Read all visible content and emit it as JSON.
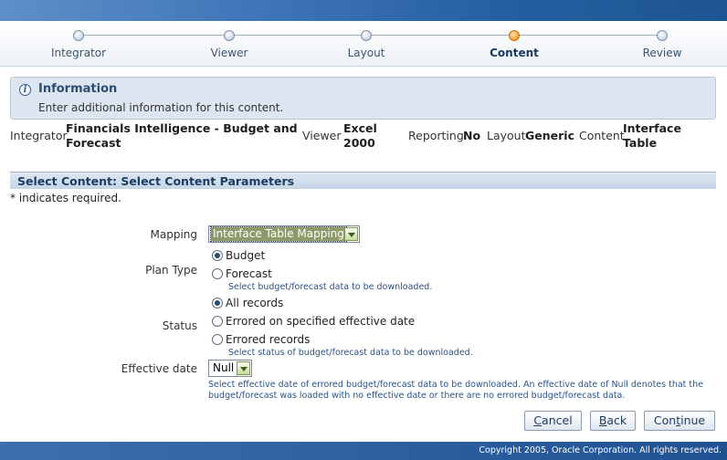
{
  "train": {
    "steps": [
      {
        "label": "Integrator"
      },
      {
        "label": "Viewer"
      },
      {
        "label": "Layout"
      },
      {
        "label": "Content"
      },
      {
        "label": "Review"
      }
    ],
    "active_step": "Content"
  },
  "info": {
    "title": "Information",
    "message": "Enter additional information for this content."
  },
  "context": {
    "integrator_label": "Integrator",
    "integrator_value_line1": "Financials Intelligence - Budget and",
    "integrator_value_line2": "Forecast",
    "viewer_label": "Viewer",
    "viewer_value_line1": "Excel",
    "viewer_value_line2": "2000",
    "reporting_label": "Reporting",
    "reporting_value": "No",
    "layout_label": "Layout",
    "layout_value": "Generic",
    "content_label": "Content",
    "content_value_line1": "Interface",
    "content_value_line2": "Table"
  },
  "section": {
    "title": "Select Content: Select Content Parameters",
    "required_note": "* indicates required."
  },
  "form": {
    "mapping_label": "Mapping",
    "mapping_value": "Interface Table Mapping",
    "plan_type_label": "Plan Type",
    "plan_type_options": [
      "Budget",
      "Forecast"
    ],
    "plan_type_selected": "Budget",
    "plan_type_hint": "Select budget/forecast data to be downloaded.",
    "status_label": "Status",
    "status_options": [
      "All records",
      "Errored on specified effective date",
      "Errored records"
    ],
    "status_selected": "All records",
    "status_hint": "Select status of budget/forecast data to be downloaded.",
    "effective_date_label": "Effective date",
    "effective_date_value": "Null",
    "effective_date_hint_line1": "Select effective date of errored budget/forecast data to be downloaded. An effective date of Null denotes that the",
    "effective_date_hint_line2": "budget/forecast was loaded with no effective date or there are no errored budget/forecast data."
  },
  "buttons": {
    "cancel_u": "C",
    "cancel_rest": "ancel",
    "back_u": "B",
    "back_rest": "ack",
    "continue_pre": "Con",
    "continue_u": "t",
    "continue_rest": "inue"
  },
  "footer": {
    "copyright": "Copyright 2005, Oracle Corporation. All rights reserved."
  },
  "colors": {
    "accent": "#1e5293",
    "active_step": "#f7a43c"
  }
}
